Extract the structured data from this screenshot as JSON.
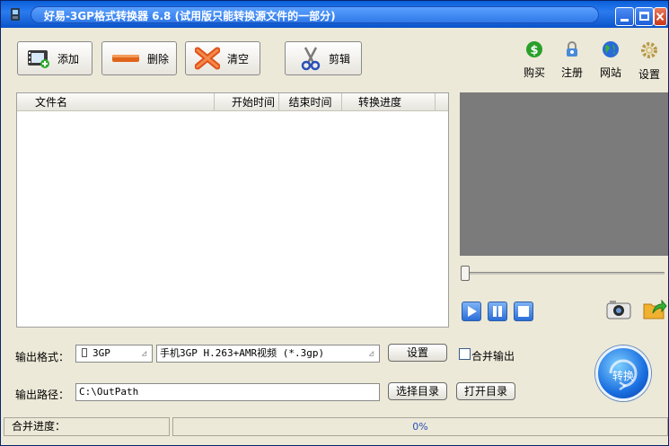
{
  "window": {
    "title": "好易-3GP格式转换器 6.8 (试用版只能转换源文件的一部分)"
  },
  "toolbar": {
    "add_label": "添加",
    "delete_label": "删除",
    "clear_label": "清空",
    "clip_label": "剪辑",
    "buy_label": "购买",
    "register_label": "注册",
    "website_label": "网站",
    "settings_label": "设置"
  },
  "filelist": {
    "columns": [
      "文件名",
      "开始时间",
      "结束时间",
      "转换进度"
    ],
    "rows": []
  },
  "output": {
    "format_label": "输出格式：",
    "format_type": "3GP",
    "format_desc": "手机3GP H.263+AMR视频 (*.3gp)",
    "settings_button": "设置",
    "merge_label": "合并输出",
    "merge_checked": false,
    "path_label": "输出路径：",
    "path_value": "C:\\OutPath",
    "select_dir_button": "选择目录",
    "open_dir_button": "打开目录",
    "convert_button": "转换"
  },
  "status": {
    "merge_progress_label": "合并进度：",
    "progress_text": "0%",
    "progress_value": 0
  },
  "colors": {
    "title_bar": "#0a5fd8",
    "window_bg": "#ece9d8",
    "preview_bg": "#7b7b7b",
    "convert_button": "#1a6fe0"
  },
  "icons": [
    "app-icon",
    "film-add-icon",
    "minus-icon",
    "x-icon",
    "scissors-icon",
    "dollar-icon",
    "lock-icon",
    "globe-icon",
    "gear-icon",
    "play-icon",
    "pause-icon",
    "stop-icon",
    "camera-icon",
    "export-icon"
  ]
}
